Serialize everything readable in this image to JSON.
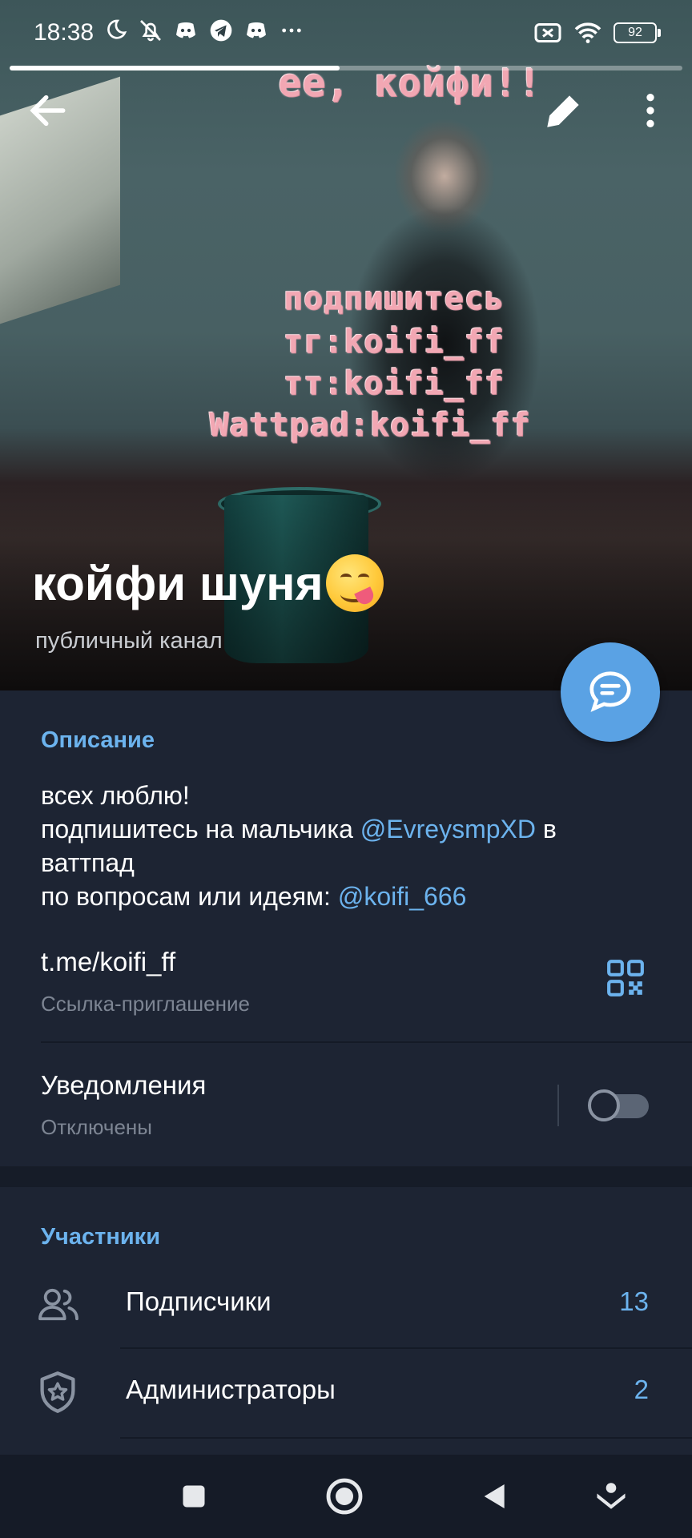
{
  "status_bar": {
    "time": "18:38",
    "left_icons": [
      "moon-icon",
      "bell-off-icon",
      "discord-icon",
      "telegram-icon",
      "discord-icon",
      "more-dots-icon"
    ],
    "battery": "92",
    "right_icons": [
      "sim-off-icon",
      "wifi-icon",
      "battery-icon"
    ]
  },
  "media_progress_percent": 49,
  "image_overlay": {
    "line1": "ее, койфи!!",
    "line2": "подпишитесь",
    "line3": "тг:koifi_ff",
    "line4": "тт:koifi_ff",
    "line5": "Wattpad:koifi_ff"
  },
  "channel": {
    "name": "койфи шуня",
    "name_emoji": "face-savoring-food-emoji",
    "type": "публичный канал"
  },
  "description": {
    "header": "Описание",
    "line1": "всех люблю!",
    "line2_prefix": "подпишитесь на мальчика ",
    "line2_mention": "@EvreysmpXD",
    "line2_suffix": " в ваттпад",
    "line3_prefix": "по вопросам или идеям: ",
    "line3_mention": "@koifi_666"
  },
  "link": {
    "url": "t.me/koifi_ff",
    "label": "Ссылка-приглашение"
  },
  "notifications": {
    "title": "Уведомления",
    "state": "Отключены",
    "enabled": false
  },
  "members": {
    "header": "Участники",
    "items": [
      {
        "label": "Подписчики",
        "count": "13",
        "icon": "people-icon"
      },
      {
        "label": "Администраторы",
        "count": "2",
        "icon": "shield-star-icon"
      }
    ]
  },
  "colors": {
    "accent": "#6cb3ee",
    "background": "#1d2433",
    "fab": "#5aa2e4"
  }
}
